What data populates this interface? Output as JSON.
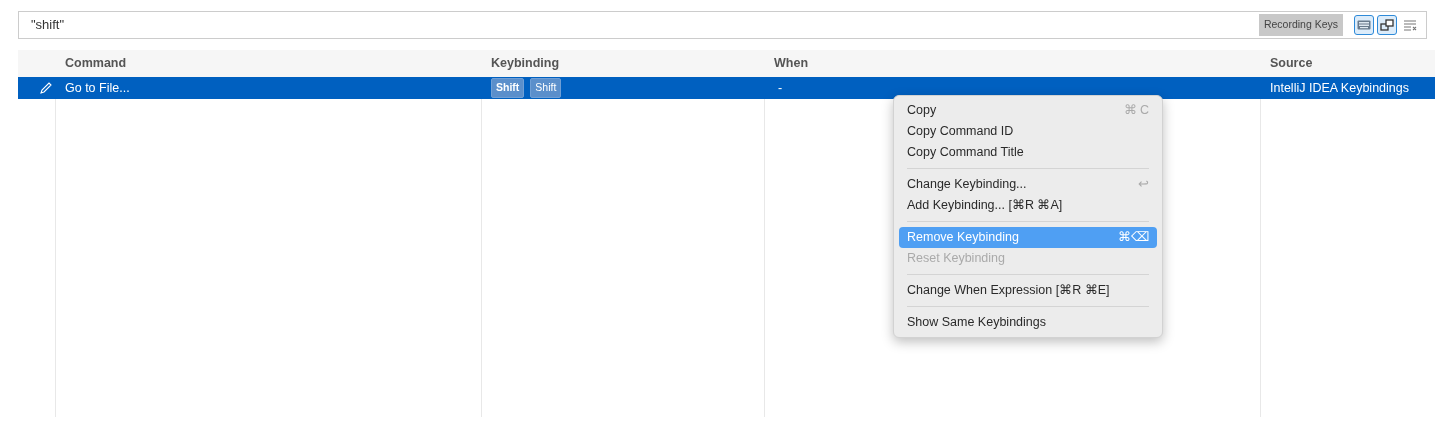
{
  "search": {
    "value": "\"shift\"",
    "recording_badge": "Recording Keys",
    "toggles": [
      {
        "kind": "keyboard",
        "selected": true
      },
      {
        "kind": "sort",
        "selected": true
      },
      {
        "kind": "clear",
        "selected": false
      }
    ]
  },
  "table": {
    "columns": [
      "Command",
      "Keybinding",
      "When",
      "Source"
    ],
    "rows": [
      {
        "selected": true,
        "command": "Go to File...",
        "keys": [
          "Shift",
          "Shift"
        ],
        "when": "-",
        "source": "IntelliJ IDEA Keybindings"
      }
    ]
  },
  "context_menu": {
    "groups": [
      [
        {
          "label": "Copy",
          "shortcut": "⌘ C",
          "selected": false,
          "disabled": false
        },
        {
          "label": "Copy Command ID",
          "selected": false,
          "disabled": false
        },
        {
          "label": "Copy Command Title",
          "selected": false,
          "disabled": false
        }
      ],
      [
        {
          "label": "Change Keybinding...",
          "shortcut": "↩",
          "selected": false,
          "disabled": false
        },
        {
          "label": "Add Keybinding... [⌘R ⌘A]",
          "selected": false,
          "disabled": false
        }
      ],
      [
        {
          "label": "Remove Keybinding",
          "shortcut": "⌘⌫",
          "selected": true,
          "disabled": false
        },
        {
          "label": "Reset Keybinding",
          "selected": false,
          "disabled": true
        }
      ],
      [
        {
          "label": "Change When Expression [⌘R ⌘E]",
          "selected": false,
          "disabled": false
        }
      ],
      [
        {
          "label": "Show Same Keybindings",
          "selected": false,
          "disabled": false
        }
      ]
    ]
  }
}
